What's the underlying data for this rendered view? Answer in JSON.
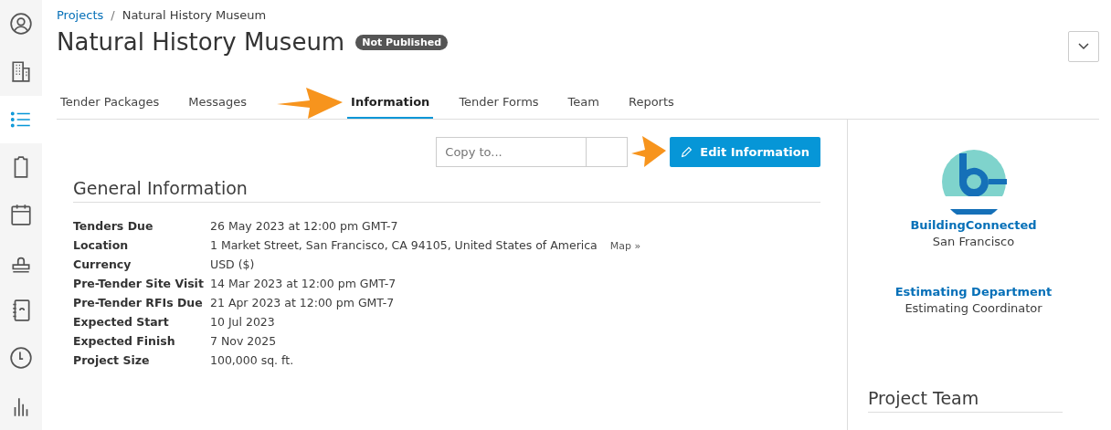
{
  "sidebar": {
    "items": [
      {
        "kind": "user",
        "selected": false
      },
      {
        "kind": "building",
        "selected": false
      },
      {
        "kind": "list",
        "selected": true
      },
      {
        "kind": "clipboard",
        "selected": false
      },
      {
        "kind": "calendar",
        "selected": false
      },
      {
        "kind": "stamp",
        "selected": false
      },
      {
        "kind": "contacts",
        "selected": false
      },
      {
        "kind": "clock",
        "selected": false
      },
      {
        "kind": "chart",
        "selected": false
      }
    ]
  },
  "breadcrumb": {
    "link": "Projects",
    "separator": "/",
    "current": "Natural History Museum"
  },
  "title": "Natural History Museum",
  "badge": "Not Published",
  "tabs": [
    {
      "label": "Tender Packages",
      "selected": false
    },
    {
      "label": "Messages",
      "selected": false
    },
    {
      "label": "Information",
      "selected": true
    },
    {
      "label": "Tender Forms",
      "selected": false
    },
    {
      "label": "Team",
      "selected": false
    },
    {
      "label": "Reports",
      "selected": false
    }
  ],
  "copy_field": {
    "placeholder": "Copy to..."
  },
  "edit_button": "Edit Information",
  "section_title": "General Information",
  "fields": [
    {
      "label": "Tenders Due",
      "value": "26 May 2023 at 12:00 pm GMT-7"
    },
    {
      "label": "Location",
      "value": "1 Market Street, San Francisco, CA 94105, United States of America",
      "link": "Map »"
    },
    {
      "label": "Currency",
      "value": "USD ($)"
    },
    {
      "label": "Pre-Tender Site Visit",
      "value": "14 Mar 2023 at 12:00 pm GMT-7"
    },
    {
      "label": "Pre-Tender RFIs Due",
      "value": "21 Apr 2023 at 12:00 pm GMT-7"
    },
    {
      "label": "Expected Start",
      "value": "10 Jul 2023"
    },
    {
      "label": "Expected Finish",
      "value": "7 Nov 2025"
    },
    {
      "label": "Project Size",
      "value": "100,000 sq. ft."
    }
  ],
  "company": {
    "name": "BuildingConnected",
    "city": "San Francisco",
    "department": "Estimating Department",
    "role": "Estimating Coordinator"
  },
  "team_title": "Project Team"
}
